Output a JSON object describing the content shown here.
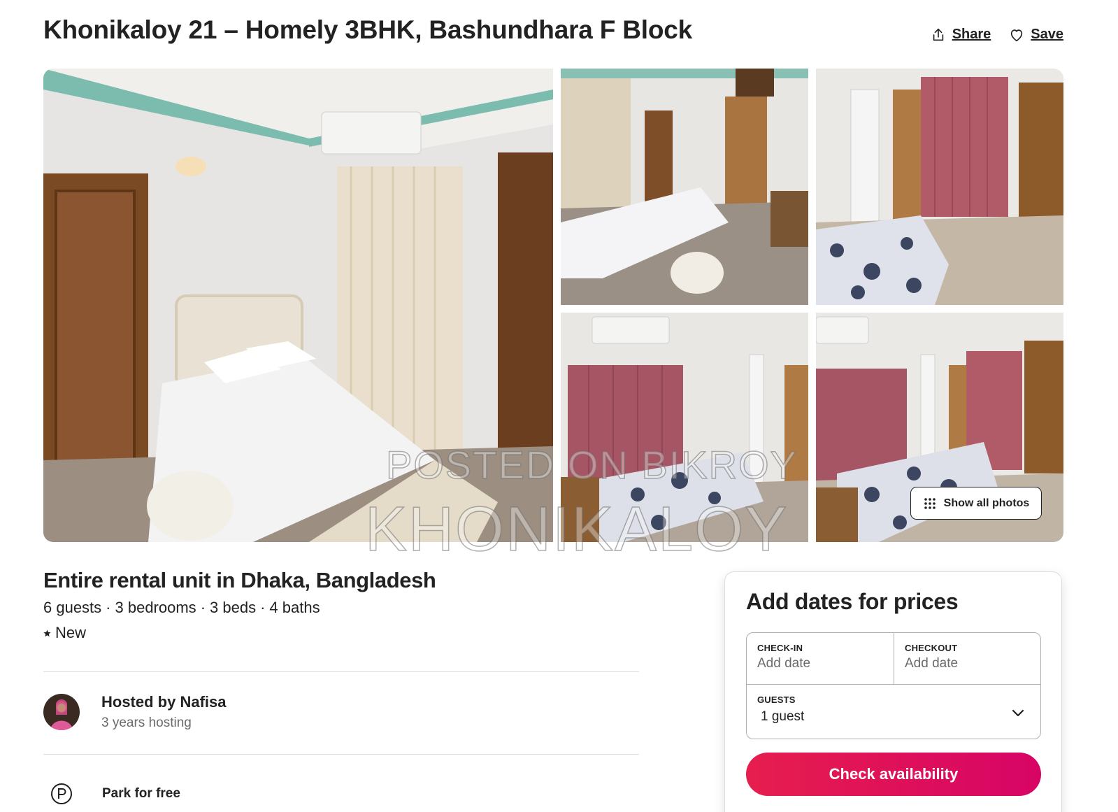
{
  "listing": {
    "title": "Khonikaloy 21 – Homely 3BHK, Bashundhara F Block"
  },
  "header_actions": {
    "share_label": "Share",
    "save_label": "Save"
  },
  "gallery": {
    "show_all_label": "Show all photos",
    "watermark_line1": "POSTED ON BIKROY",
    "watermark_line2": "KHONIKALOY"
  },
  "overview": {
    "subtitle": "Entire rental unit in Dhaka, Bangladesh",
    "specs": [
      "6 guests",
      "3 bedrooms",
      "3 beds",
      "4 baths"
    ],
    "rating_label": "New"
  },
  "host": {
    "name_line": "Hosted by Nafisa",
    "years_line": "3 years hosting"
  },
  "amenities": [
    {
      "icon": "parking-icon",
      "label": "Park for free"
    }
  ],
  "booking": {
    "title": "Add dates for prices",
    "checkin_label": "CHECK-IN",
    "checkin_value": "Add date",
    "checkout_label": "CHECKOUT",
    "checkout_value": "Add date",
    "guests_label": "GUESTS",
    "guests_value": "1 guest",
    "button_label": "Check availability"
  },
  "colors": {
    "brand": "#e61e4d",
    "text": "#222222",
    "muted": "#6a6a6a",
    "border": "#dddddd"
  }
}
